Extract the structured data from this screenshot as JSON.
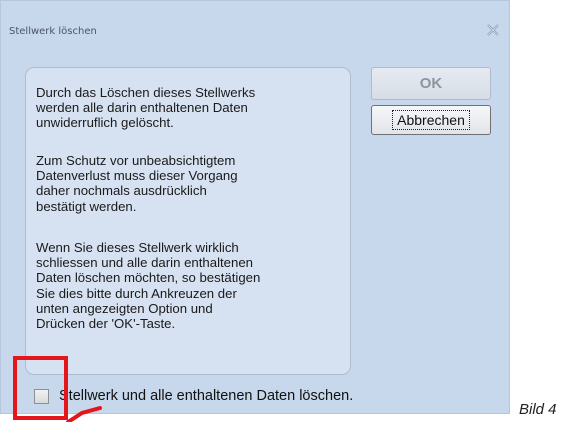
{
  "dialog": {
    "title": "Stellwerk löschen",
    "close_icon": "close-icon",
    "info": {
      "paragraph_1": "Durch das Löschen dieses Stellwerks\nwerden alle darin enthaltenen Daten\nunwiderruflich gelöscht.",
      "paragraph_2": "Zum Schutz vor unbeabsichtigtem\nDatenverlust muss dieser Vorgang\ndaher nochmals ausdrücklich\nbestätigt werden.",
      "paragraph_3": "Wenn Sie dieses Stellwerk wirklich\nschliessen und alle darin enthaltenen\nDaten löschen möchten, so bestätigen\nSie dies bitte durch Ankreuzen der\nunten angezeigten Option und\nDrücken der 'OK'-Taste."
    },
    "buttons": {
      "ok_label": "OK",
      "cancel_label": "Abbrechen"
    },
    "option": {
      "label": "Stellwerk und alle enthaltenen Daten löschen.",
      "checked": false
    }
  },
  "annotation": {
    "caption": "Bild 4",
    "highlight_color": "#e3161b"
  },
  "colors": {
    "dialog_background": "#c7d7ec",
    "panel_background": "#d6e2f2",
    "highlight": "#e3161b"
  }
}
